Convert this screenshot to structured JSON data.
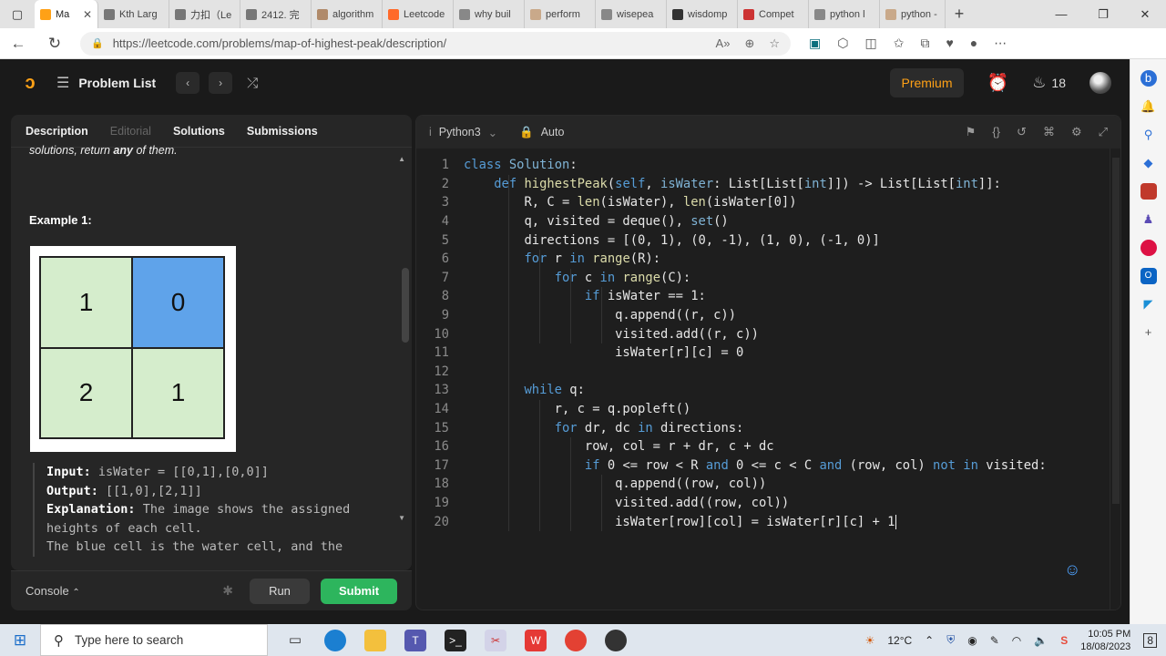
{
  "browser": {
    "tabs": [
      {
        "label": "Ma",
        "active": true
      },
      {
        "label": "Kth Larg",
        "active": false
      },
      {
        "label": "力扣（Le",
        "active": false
      },
      {
        "label": "2412. 完",
        "active": false
      },
      {
        "label": "algorithm",
        "active": false
      },
      {
        "label": "Leetcode",
        "active": false
      },
      {
        "label": "why buil",
        "active": false
      },
      {
        "label": "perform",
        "active": false
      },
      {
        "label": "wisepea",
        "active": false
      },
      {
        "label": "wisdomp",
        "active": false
      },
      {
        "label": "Compet",
        "active": false
      },
      {
        "label": "python l",
        "active": false
      },
      {
        "label": "python -",
        "active": false
      }
    ],
    "url": "https://leetcode.com/problems/map-of-highest-peak/description/"
  },
  "header": {
    "problem_list": "Problem List",
    "premium": "Premium",
    "streak": "18"
  },
  "left_panel": {
    "tabs": [
      "Description",
      "Editorial",
      "Solutions",
      "Submissions"
    ],
    "intro_tail_plain": "solutions, return ",
    "intro_tail_bold": "any",
    "intro_tail_end": " of them.",
    "example_title": "Example 1:",
    "grid": [
      "1",
      "0",
      "2",
      "1"
    ],
    "input_label": "Input:",
    "input_value": "isWater = [[0,1],[0,0]]",
    "output_label": "Output:",
    "output_value": "[[1,0],[2,1]]",
    "explanation_label": "Explanation:",
    "explanation_text": "The image shows the assigned heights of each cell.",
    "explanation_text2": "The blue cell is the water cell, and the"
  },
  "console": {
    "label": "Console",
    "run": "Run",
    "submit": "Submit"
  },
  "editor": {
    "language": "Python3",
    "mode": "Auto",
    "lines": [
      "1",
      "2",
      "3",
      "4",
      "5",
      "6",
      "7",
      "8",
      "9",
      "10",
      "11",
      "12",
      "13",
      "14",
      "15",
      "16",
      "17",
      "18",
      "19",
      "20"
    ]
  },
  "taskbar": {
    "search_placeholder": "Type here to search",
    "weather": "12°C",
    "time": "10:05 PM",
    "date": "18/08/2023",
    "notifications": "8"
  },
  "colors": {
    "accent": "#ffa116",
    "submit_green": "#2db55d",
    "water_blue": "#5fa3ea",
    "land_green": "#d5edcc"
  }
}
